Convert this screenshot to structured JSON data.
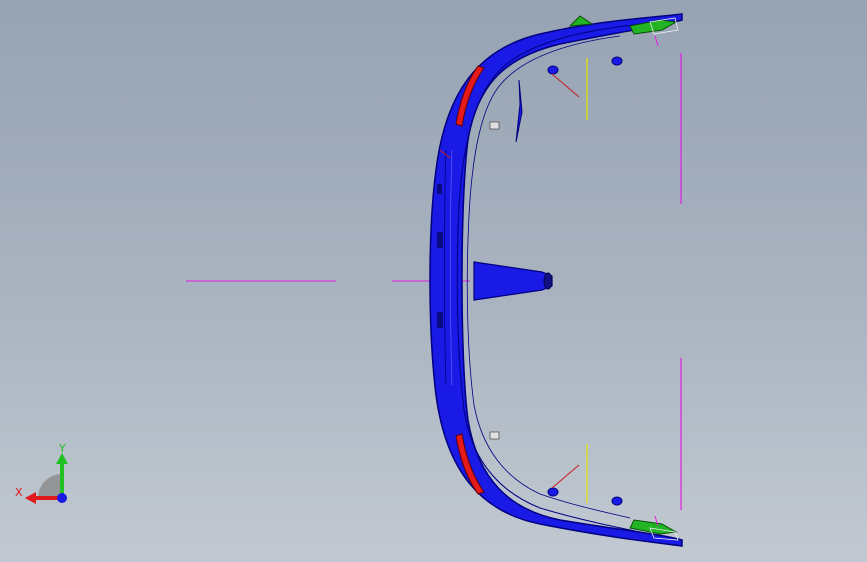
{
  "viewport": {
    "background_top": "#97a3b3",
    "background_bottom": "#c2c9d1"
  },
  "model": {
    "part_color": "#1a1ae6",
    "part_edge_color": "#000080",
    "highlight_color": "#e61a1a",
    "clip_color": "#22b422",
    "reference_line_color": "#e01ee0",
    "sketch_line_color": "#e6e600",
    "dimension_leader_color": "#c81e1e"
  },
  "triad": {
    "x_label": "X",
    "y_label": "Y",
    "x_color": "#e01a1a",
    "y_color": "#22c022",
    "z_color": "#1a1ae6"
  }
}
